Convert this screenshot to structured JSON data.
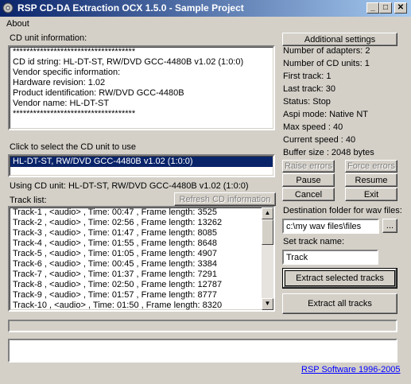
{
  "window": {
    "title": "RSP CD-DA Extraction OCX 1.5.0 - Sample Project",
    "min_glyph": "_",
    "max_glyph": "□",
    "close_glyph": "✕"
  },
  "menu": {
    "about": "About"
  },
  "cd_info": {
    "label": "CD unit information:",
    "lines": [
      "************************************",
      "CD id string: HL-DT-ST, RW/DVD GCC-4480B v1.02 (1:0:0)",
      "Vendor specific information:",
      "Hardware revision: 1.02",
      "Product identification: RW/DVD GCC-4480B",
      "Vendor name: HL-DT-ST",
      "************************************"
    ]
  },
  "select_unit": {
    "label": "Click to select the CD unit to use",
    "selected": "HL-DT-ST, RW/DVD GCC-4480B v1.02 (1:0:0)"
  },
  "using_unit": "Using CD unit: HL-DT-ST, RW/DVD GCC-4480B v1.02 (1:0:0)",
  "tracks": {
    "label": "Track list:",
    "refresh_label": "Refresh CD information",
    "rows": [
      "Track-1 , <audio> ,  Time: 00:47 , Frame length: 3525",
      "Track-2 , <audio> ,  Time: 02:56 , Frame length: 13262",
      "Track-3 , <audio> ,  Time: 01:47 , Frame length: 8085",
      "Track-4 , <audio> ,  Time: 01:55 , Frame length: 8648",
      "Track-5 , <audio> ,  Time: 01:05 , Frame length: 4907",
      "Track-6 , <audio> ,  Time: 00:45 , Frame length: 3384",
      "Track-7 , <audio> ,  Time: 01:37 , Frame length: 7291",
      "Track-8 , <audio> ,  Time: 02:50 , Frame length: 12787",
      "Track-9 , <audio> ,  Time: 01:57 , Frame length: 8777",
      "Track-10 , <audio> ,  Time: 01:50 , Frame length: 8320"
    ]
  },
  "right_panel": {
    "additional_settings": "Additional settings",
    "info": [
      "Number of adapters: 2",
      "Number of CD units: 1",
      "First track: 1",
      "Last track: 30",
      "Status: Stop",
      "Aspi mode:  Native NT",
      "Max speed : 40",
      "Current speed : 40",
      "Buffer size : 2048 bytes"
    ],
    "raise_errors": "Raise errors",
    "force_errors": "Force errors",
    "pause": "Pause",
    "resume": "Resume",
    "cancel": "Cancel",
    "exit": "Exit",
    "dest_label": "Destination folder for wav files:",
    "dest_value": "c:\\my wav files\\files",
    "browse": "...",
    "track_name_label": "Set track name:",
    "track_name_value": "Track",
    "extract_selected": "Extract selected tracks",
    "extract_all": "Extract all tracks"
  },
  "footer": {
    "progress": 0,
    "link": "RSP Software 1996-2005"
  }
}
